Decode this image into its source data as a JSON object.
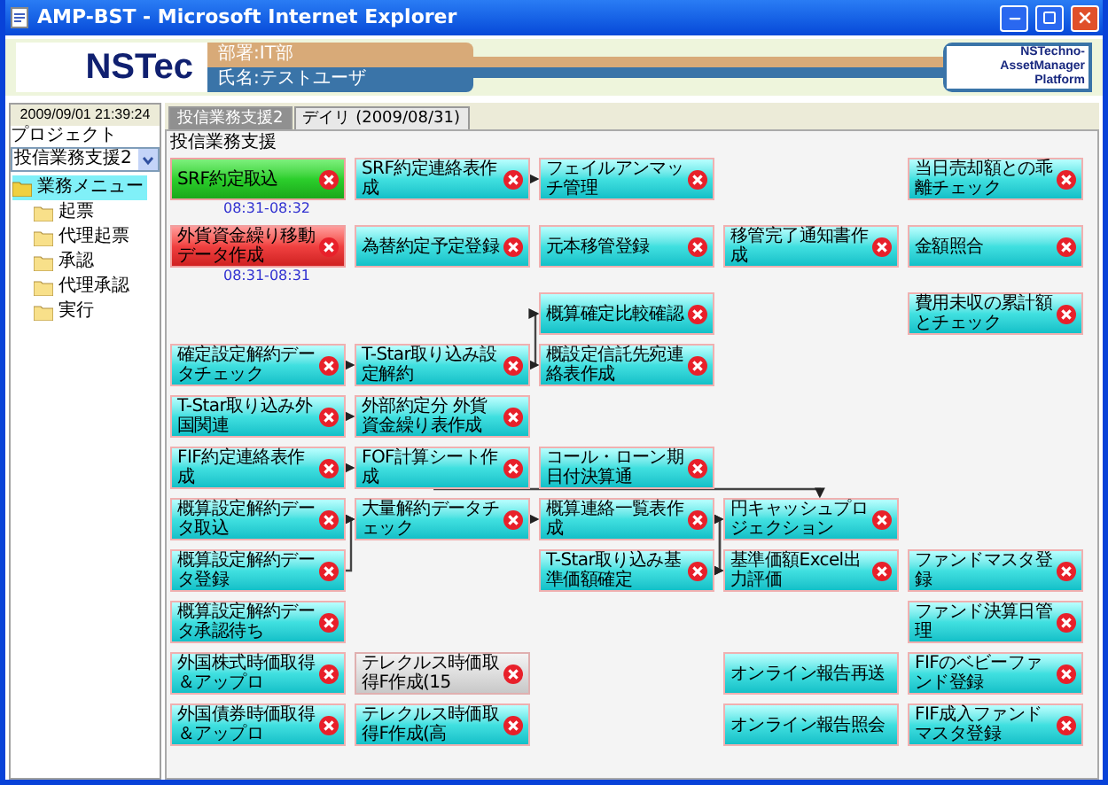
{
  "window": {
    "title": "AMP-BST - Microsoft Internet Explorer"
  },
  "header": {
    "logo": "NSTec",
    "department": "部署:IT部",
    "user": "氏名:テストユーザ",
    "platform_logo": [
      "NSTechno-",
      "AssetManager",
      "Platform"
    ]
  },
  "sidebar": {
    "datetime": "2009/09/01 21:39:24",
    "project_label": "プロジェクト",
    "project_value": "投信業務支援2",
    "tree": [
      {
        "label": "業務メニュー",
        "expanded": true,
        "selected": true,
        "children": [
          {
            "label": "起票",
            "selected": false
          },
          {
            "label": "代理起票",
            "selected": false
          },
          {
            "label": "承認",
            "selected": false
          },
          {
            "label": "代理承認",
            "selected": false
          },
          {
            "label": "実行",
            "selected": false
          }
        ]
      }
    ]
  },
  "tabs": [
    {
      "label": "投信業務支援2",
      "selected": true
    },
    {
      "label": "デイリ (2009/08/31)",
      "selected": false
    }
  ],
  "workflow": {
    "title": "投信業務支援",
    "nodes": [
      {
        "text": "SRF約定取込",
        "kind": "done",
        "time": "08:31-08:32",
        "cancel_icon": true
      },
      {
        "text": "SRF約定連絡表作成",
        "kind": "pending",
        "cancel_icon": true
      },
      {
        "text": "フェイルアンマッチ管理",
        "kind": "pending",
        "cancel_icon": true
      },
      {
        "text": "当日売却額との乖離チェック",
        "kind": "pending",
        "cancel_icon": true
      },
      {
        "text": "外貨資金繰り移動データ作成",
        "kind": "error",
        "time": "08:31-08:31",
        "cancel_icon": true
      },
      {
        "text": "為替約定予定登録",
        "kind": "pending",
        "cancel_icon": true
      },
      {
        "text": "元本移管登録",
        "kind": "pending",
        "cancel_icon": true
      },
      {
        "text": "移管完了通知書作成",
        "kind": "pending",
        "cancel_icon": true
      },
      {
        "text": "金額照合",
        "kind": "pending",
        "cancel_icon": true
      },
      {
        "text": "概算確定比較確認",
        "kind": "pending",
        "cancel_icon": true
      },
      {
        "text": "費用未収の累計額とチェック",
        "kind": "pending",
        "cancel_icon": true
      },
      {
        "text": "確定設定解約データチェック",
        "kind": "pending",
        "cancel_icon": true
      },
      {
        "text": "T-Star取り込み設定解約",
        "kind": "pending",
        "cancel_icon": true
      },
      {
        "text": "概設定信託先宛連絡表作成",
        "kind": "pending",
        "cancel_icon": true
      },
      {
        "text": "T-Star取り込み外国関連",
        "kind": "pending",
        "cancel_icon": true
      },
      {
        "text": "外部約定分 外貨資金繰り表作成",
        "kind": "pending",
        "cancel_icon": true
      },
      {
        "text": "FIF約定連絡表作成",
        "kind": "pending",
        "cancel_icon": true
      },
      {
        "text": "FOF計算シート作成",
        "kind": "pending",
        "cancel_icon": true
      },
      {
        "text": "コール・ローン期日付決算通",
        "kind": "pending",
        "cancel_icon": true
      },
      {
        "text": "概算設定解約データ取込",
        "kind": "pending",
        "cancel_icon": true
      },
      {
        "text": "大量解約データチェック",
        "kind": "pending",
        "cancel_icon": true
      },
      {
        "text": "概算連絡一覧表作成",
        "kind": "pending",
        "cancel_icon": true
      },
      {
        "text": "円キャッシュプロジェクション",
        "kind": "pending",
        "cancel_icon": true
      },
      {
        "text": "概算設定解約データ登録",
        "kind": "pending",
        "cancel_icon": true
      },
      {
        "text": "T-Star取り込み基準価額確定",
        "kind": "pending",
        "cancel_icon": true
      },
      {
        "text": "基準価額Excel出力評価",
        "kind": "pending",
        "cancel_icon": true
      },
      {
        "text": "ファンドマスタ登録",
        "kind": "pending",
        "cancel_icon": true
      },
      {
        "text": "概算設定解約データ承認待ち",
        "kind": "pending",
        "cancel_icon": true
      },
      {
        "text": "ファンド決算日管理",
        "kind": "pending",
        "cancel_icon": true
      },
      {
        "text": "外国株式時価取得＆アップロ",
        "kind": "pending",
        "cancel_icon": true
      },
      {
        "text": "テレクルス時価取得F作成(15",
        "kind": "disabled",
        "cancel_icon": true
      },
      {
        "text": "オンライン報告再送",
        "kind": "pending",
        "cancel_icon": false
      },
      {
        "text": "FIFのベビーファンド登録",
        "kind": "pending",
        "cancel_icon": true
      },
      {
        "text": "外国債券時価取得＆アップロ",
        "kind": "pending",
        "cancel_icon": true
      },
      {
        "text": "テレクルス時価取得F作成(高",
        "kind": "pending",
        "cancel_icon": true
      },
      {
        "text": "オンライン報告照会",
        "kind": "pending",
        "cancel_icon": false
      },
      {
        "text": "FIF成入ファンドマスタ登録",
        "kind": "pending",
        "cancel_icon": true
      }
    ]
  }
}
